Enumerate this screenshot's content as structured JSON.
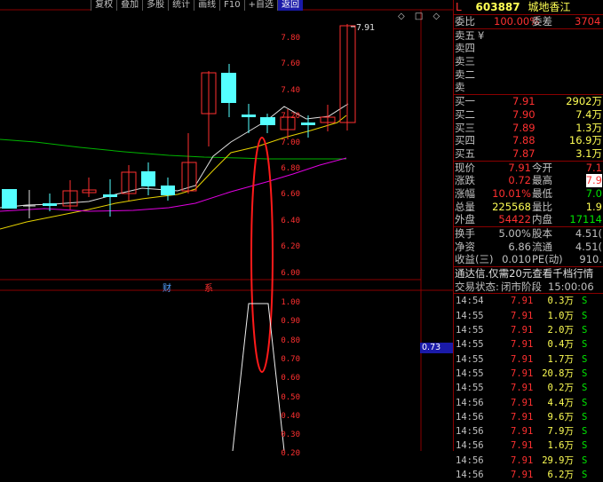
{
  "toolbar": [
    "复权",
    "叠加",
    "多股",
    "统计",
    "画线",
    "F10",
    "+自选",
    "返回"
  ],
  "ctrl_icons": "◇ □ ◇",
  "price_axis": [
    "7.80",
    "7.60",
    "7.40",
    "7.20",
    "7.00",
    "6.80",
    "6.60",
    "6.40",
    "6.20",
    "6.00"
  ],
  "ind_axis": [
    "1.00",
    "0.90",
    "0.80",
    "0.70",
    "0.60",
    "0.50",
    "0.40",
    "0.30",
    "0.20"
  ],
  "cursor_value": "0.73",
  "high_label": "7.91",
  "events": {
    "cai": "财",
    "xi": "系"
  },
  "header": {
    "mark": "L",
    "code": "603887",
    "name": "城地香江"
  },
  "weibi": {
    "label": "委比",
    "value": "100.00%",
    "label2": "委差",
    "value2": "3704"
  },
  "asks": [
    {
      "label": "卖五",
      "extra": "¥"
    },
    {
      "label": "卖四"
    },
    {
      "label": "卖三"
    },
    {
      "label": "卖二"
    },
    {
      "label": "卖"
    }
  ],
  "bids": [
    {
      "label": "买一",
      "price": "7.91",
      "vol": "2902万"
    },
    {
      "label": "买二",
      "price": "7.90",
      "vol": "7.4万"
    },
    {
      "label": "买三",
      "price": "7.89",
      "vol": "1.3万"
    },
    {
      "label": "买四",
      "price": "7.88",
      "vol": "16.9万"
    },
    {
      "label": "买五",
      "price": "7.87",
      "vol": "3.1万"
    }
  ],
  "quote": [
    {
      "l1": "现价",
      "v1": "7.91",
      "l2": "今开",
      "v2": "7.1"
    },
    {
      "l1": "涨跌",
      "v1": "0.72",
      "l2": "最高",
      "v2": "7.9"
    },
    {
      "l1": "涨幅",
      "v1": "10.01%",
      "l2": "最低",
      "v2": "7.0"
    },
    {
      "l1": "总量",
      "v1": "225568",
      "l2": "量比",
      "v2": "1.9"
    },
    {
      "l1": "外盘",
      "v1": "54422",
      "l2": "内盘",
      "v2": "17114"
    }
  ],
  "stats": [
    {
      "l1": "换手",
      "v1": "5.00%",
      "l2": "股本",
      "v2": "4.51("
    },
    {
      "l1": "净资",
      "v1": "6.86",
      "l2": "流通",
      "v2": "4.51("
    },
    {
      "l1": "收益(三)",
      "v1": "0.010",
      "l2": "PE(动)",
      "v2": "910."
    }
  ],
  "promo": "通达信.仅需20元查看千档行情",
  "trade_status": {
    "label": "交易状态:",
    "value": "闭市阶段",
    "time": "15:00:06"
  },
  "ticks": [
    {
      "t": "14:54",
      "p": "7.91",
      "v": "0.3万",
      "s": "S"
    },
    {
      "t": "14:55",
      "p": "7.91",
      "v": "1.0万",
      "s": "S"
    },
    {
      "t": "14:55",
      "p": "7.91",
      "v": "2.0万",
      "s": "S"
    },
    {
      "t": "14:55",
      "p": "7.91",
      "v": "0.4万",
      "s": "S"
    },
    {
      "t": "14:55",
      "p": "7.91",
      "v": "1.7万",
      "s": "S"
    },
    {
      "t": "14:55",
      "p": "7.91",
      "v": "20.8万",
      "s": "S"
    },
    {
      "t": "14:55",
      "p": "7.91",
      "v": "0.2万",
      "s": "S"
    },
    {
      "t": "14:56",
      "p": "7.91",
      "v": "4.4万",
      "s": "S"
    },
    {
      "t": "14:56",
      "p": "7.91",
      "v": "9.6万",
      "s": "S"
    },
    {
      "t": "14:56",
      "p": "7.91",
      "v": "7.9万",
      "s": "S"
    },
    {
      "t": "14:56",
      "p": "7.91",
      "v": "1.6万",
      "s": "S"
    },
    {
      "t": "14:56",
      "p": "7.91",
      "v": "29.9万",
      "s": "S"
    },
    {
      "t": "14:56",
      "p": "7.91",
      "v": "6.2万",
      "s": "S"
    }
  ]
}
